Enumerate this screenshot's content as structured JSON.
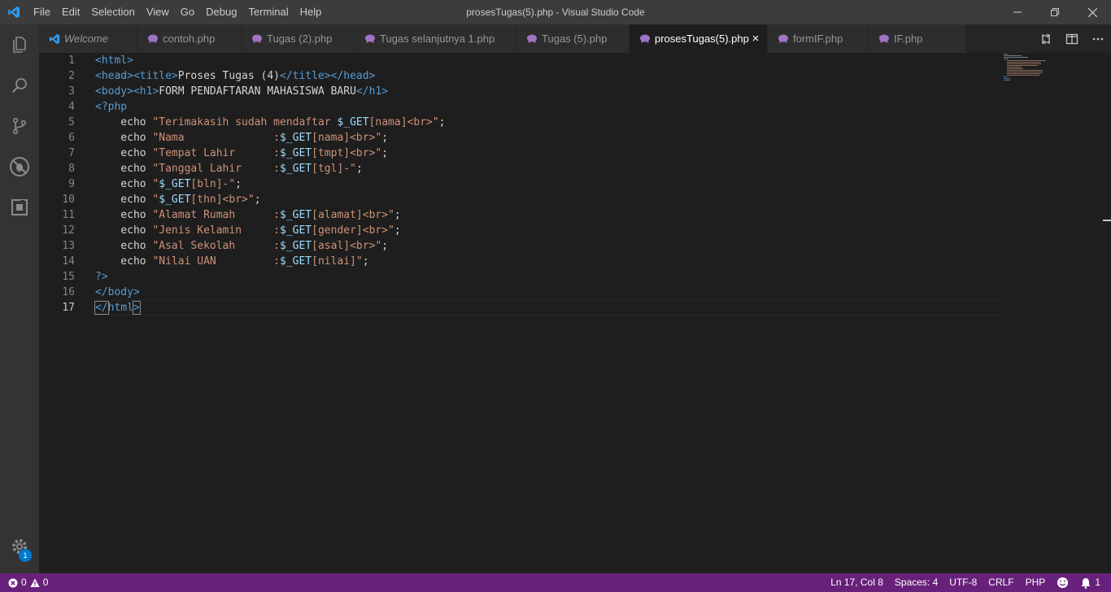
{
  "window": {
    "title": "prosesTugas(5).php - Visual Studio Code"
  },
  "menu": [
    "File",
    "Edit",
    "Selection",
    "View",
    "Go",
    "Debug",
    "Terminal",
    "Help"
  ],
  "tabs": [
    {
      "label": "Welcome",
      "icon": "vscode-icon",
      "italic": true,
      "active": false
    },
    {
      "label": "contoh.php",
      "icon": "php-elephant-icon",
      "active": false
    },
    {
      "label": "Tugas (2).php",
      "icon": "php-elephant-icon",
      "active": false
    },
    {
      "label": "Tugas selanjutnya 1.php",
      "icon": "php-elephant-icon",
      "active": false
    },
    {
      "label": "Tugas (5).php",
      "icon": "php-elephant-icon",
      "active": false
    },
    {
      "label": "prosesTugas(5).php",
      "icon": "php-elephant-icon",
      "active": true
    },
    {
      "label": "formIF.php",
      "icon": "php-elephant-icon",
      "active": false
    },
    {
      "label": "IF.php",
      "icon": "php-elephant-icon",
      "active": false
    }
  ],
  "editor": {
    "line_numbers": [
      "1",
      "2",
      "3",
      "4",
      "5",
      "6",
      "7",
      "8",
      "9",
      "10",
      "11",
      "12",
      "13",
      "14",
      "15",
      "16",
      "17"
    ],
    "current_line": 17,
    "lines": [
      [
        [
          "tag",
          "<html>"
        ]
      ],
      [
        [
          "tag",
          "<head>"
        ],
        [
          "tag",
          "<title>"
        ],
        [
          "txt",
          "Proses Tugas (4)"
        ],
        [
          "tag",
          "</title>"
        ],
        [
          "tag",
          "</head>"
        ]
      ],
      [
        [
          "tag",
          "<body>"
        ],
        [
          "tag",
          "<h1>"
        ],
        [
          "txt",
          "FORM PENDAFTARAN MAHASISWA BARU"
        ],
        [
          "tag",
          "</h1>"
        ]
      ],
      [
        [
          "tag",
          "<?php"
        ]
      ],
      [
        [
          "kw",
          "    echo "
        ],
        [
          "str",
          "\"Terimakasih sudah mendaftar "
        ],
        [
          "var",
          "$_GET"
        ],
        [
          "str",
          "[nama]<br>\""
        ],
        [
          "kw",
          ";"
        ]
      ],
      [
        [
          "kw",
          "    echo "
        ],
        [
          "str",
          "\"Nama              :"
        ],
        [
          "var",
          "$_GET"
        ],
        [
          "str",
          "[nama]<br>\""
        ],
        [
          "kw",
          ";"
        ]
      ],
      [
        [
          "kw",
          "    echo "
        ],
        [
          "str",
          "\"Tempat Lahir      :"
        ],
        [
          "var",
          "$_GET"
        ],
        [
          "str",
          "[tmpt]<br>\""
        ],
        [
          "kw",
          ";"
        ]
      ],
      [
        [
          "kw",
          "    echo "
        ],
        [
          "str",
          "\"Tanggal Lahir     :"
        ],
        [
          "var",
          "$_GET"
        ],
        [
          "str",
          "[tgl]-\""
        ],
        [
          "kw",
          ";"
        ]
      ],
      [
        [
          "kw",
          "    echo "
        ],
        [
          "str",
          "\""
        ],
        [
          "var",
          "$_GET"
        ],
        [
          "str",
          "[bln]-\""
        ],
        [
          "kw",
          ";"
        ]
      ],
      [
        [
          "kw",
          "    echo "
        ],
        [
          "str",
          "\""
        ],
        [
          "var",
          "$_GET"
        ],
        [
          "str",
          "[thn]<br>\""
        ],
        [
          "kw",
          ";"
        ]
      ],
      [
        [
          "kw",
          "    echo "
        ],
        [
          "str",
          "\"Alamat Rumah      :"
        ],
        [
          "var",
          "$_GET"
        ],
        [
          "str",
          "[alamat]<br>\""
        ],
        [
          "kw",
          ";"
        ]
      ],
      [
        [
          "kw",
          "    echo "
        ],
        [
          "str",
          "\"Jenis Kelamin     :"
        ],
        [
          "var",
          "$_GET"
        ],
        [
          "str",
          "[gender]<br>\""
        ],
        [
          "kw",
          ";"
        ]
      ],
      [
        [
          "kw",
          "    echo "
        ],
        [
          "str",
          "\"Asal Sekolah      :"
        ],
        [
          "var",
          "$_GET"
        ],
        [
          "str",
          "[asal]<br>\""
        ],
        [
          "kw",
          ";"
        ]
      ],
      [
        [
          "kw",
          "    echo "
        ],
        [
          "str",
          "\"Nilai UAN         :"
        ],
        [
          "var",
          "$_GET"
        ],
        [
          "str",
          "[nilai]\""
        ],
        [
          "kw",
          ";"
        ]
      ],
      [
        [
          "tag",
          "?>"
        ]
      ],
      [
        [
          "tag",
          "</body>"
        ]
      ],
      [
        [
          "tag",
          "</"
        ],
        [
          "tag",
          "html"
        ],
        [
          "tag",
          ">"
        ]
      ]
    ]
  },
  "status": {
    "errors": "0",
    "warnings": "0",
    "position": "Ln 17, Col 8",
    "spaces": "Spaces: 4",
    "encoding": "UTF-8",
    "eol": "CRLF",
    "language": "PHP",
    "notifications": "1"
  },
  "activity": {
    "settings_badge": "1"
  },
  "colors": {
    "statusbar": "#68217a",
    "accent": "#007acc"
  }
}
